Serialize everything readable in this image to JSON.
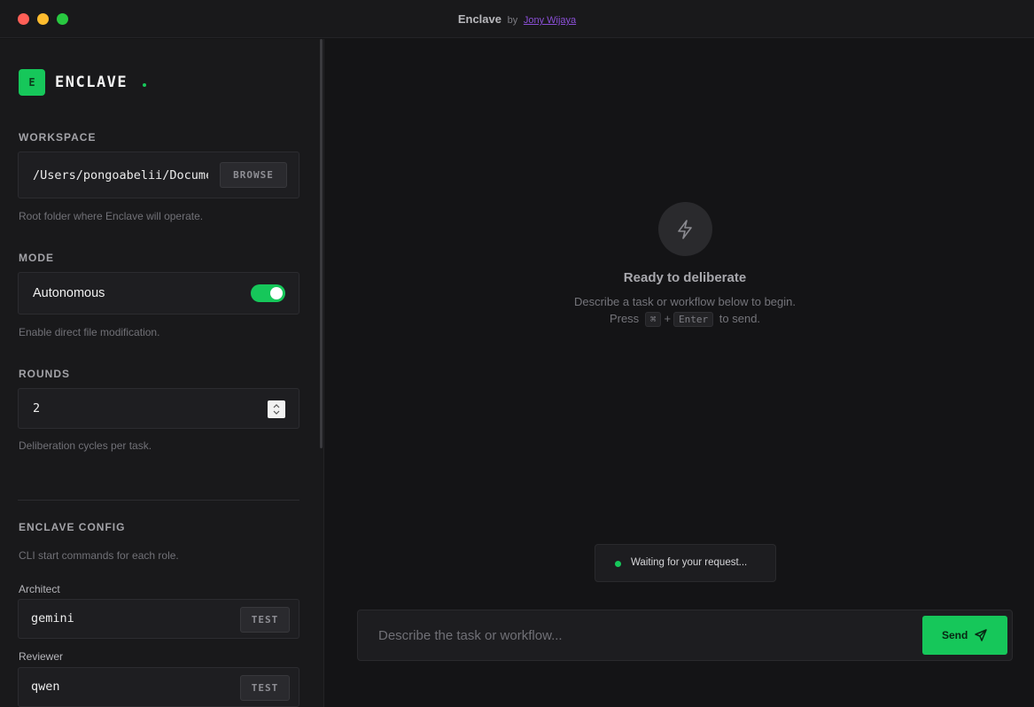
{
  "window": {
    "app_name": "Enclave",
    "by": "by",
    "author": "Jony Wijaya"
  },
  "sidebar": {
    "logo_letter": "E",
    "logo_text": "ENCLAVE",
    "workspace": {
      "label": "WORKSPACE",
      "path": "/Users/pongoabelii/Documents",
      "browse_label": "BROWSE",
      "helper": "Root folder where Enclave will operate."
    },
    "mode": {
      "label": "MODE",
      "value": "Autonomous",
      "enabled": true,
      "helper": "Enable direct file modification."
    },
    "rounds": {
      "label": "ROUNDS",
      "value": "2",
      "helper": "Deliberation cycles per task."
    },
    "config": {
      "label": "ENCLAVE CONFIG",
      "helper": "CLI start commands for each role.",
      "roles": [
        {
          "name": "Architect",
          "command": "gemini",
          "test_label": "TEST"
        },
        {
          "name": "Reviewer",
          "command": "qwen",
          "test_label": "TEST"
        }
      ]
    }
  },
  "main": {
    "empty_state": {
      "icon": "lightning-bolt-icon",
      "title": "Ready to deliberate",
      "description": "Describe a task or workflow below to begin.",
      "press_prefix": "Press",
      "key_cmd": "⌘",
      "plus": "+",
      "key_enter": "Enter",
      "press_suffix": "to send."
    },
    "status": {
      "text": "Waiting for your request...",
      "color": "#16c75a"
    },
    "composer": {
      "placeholder": "Describe the task or workflow...",
      "send_label": "Send"
    }
  },
  "colors": {
    "accent": "#16c75a",
    "background": "#141416",
    "sidebar": "#19191b",
    "author_link": "#8a4fd6"
  }
}
